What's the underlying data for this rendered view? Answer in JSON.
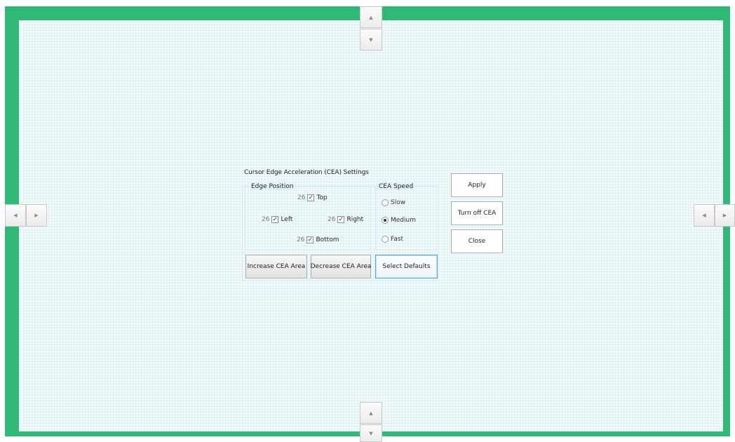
{
  "arrows": {
    "top_up": "▲",
    "top_down": "▼",
    "bottom_up": "▲",
    "bottom_down": "▼",
    "left_left": "◀",
    "left_right": "▶",
    "right_left": "◀",
    "right_right": "▶"
  },
  "dialog": {
    "title": "Cursor Edge Acceleration (CEA) Settings",
    "edge_position": {
      "label": "Edge Position",
      "top": {
        "value": "26",
        "label": "Top",
        "checked": "✓"
      },
      "left": {
        "value": "26",
        "label": "Left",
        "checked": "✓"
      },
      "right": {
        "value": "26",
        "label": "Right",
        "checked": "✓"
      },
      "bottom": {
        "value": "26",
        "label": "Bottom",
        "checked": "✓"
      }
    },
    "cea_speed": {
      "label": "CEA Speed",
      "options": [
        "Slow",
        "Medium",
        "Fast"
      ],
      "selected": "Medium"
    },
    "buttons": {
      "increase": "Increase CEA Area",
      "decrease": "Decrease CEA Area",
      "defaults": "Select Defaults",
      "apply": "Apply",
      "turn_off": "Turn off CEA",
      "close": "Close"
    }
  },
  "colors": {
    "frame": "#2fb876",
    "grid": "#e2f3f8",
    "focus": "#4fa6d6"
  }
}
